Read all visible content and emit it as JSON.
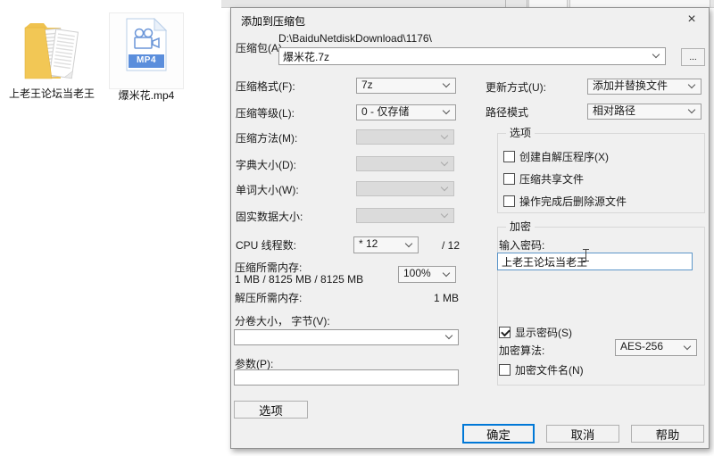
{
  "colors": {
    "accent": "#0078d7",
    "mp4_badge": "#5b8edc",
    "folder_yellow": "#efc24f",
    "dialog_bg": "#f0f0f0"
  },
  "desktop": {
    "folder": {
      "label": "上老王论坛当老王"
    },
    "file": {
      "label": "爆米花.mp4",
      "badge": "MP4"
    }
  },
  "dialog": {
    "title": "添加到压缩包",
    "close_glyph": "×",
    "archive": {
      "label": "压缩包(A)",
      "path": "D:\\BaiduNetdiskDownload\\1176\\",
      "name": "爆米花.7z",
      "browse": "..."
    },
    "format": {
      "label": "压缩格式(F):",
      "value": "7z"
    },
    "level": {
      "label": "压缩等级(L):",
      "value": "0 - 仅存储"
    },
    "method": {
      "label": "压缩方法(M):",
      "value": ""
    },
    "dict": {
      "label": "字典大小(D):",
      "value": ""
    },
    "word": {
      "label": "单词大小(W):",
      "value": ""
    },
    "solid": {
      "label": "固实数据大小:",
      "value": ""
    },
    "cpu": {
      "label": "CPU 线程数:",
      "value": "* 12",
      "suffix": "/ 12"
    },
    "mem_compress": {
      "label": "压缩所需内存:",
      "detail": "1 MB / 8125 MB / 8125 MB",
      "percent": "100%"
    },
    "mem_decompress": {
      "label": "解压所需内存:",
      "value": "1 MB"
    },
    "volume": {
      "label": "分卷大小， 字节(V):",
      "value": ""
    },
    "params": {
      "label": "参数(P):",
      "value": ""
    },
    "options_button": "选项",
    "update": {
      "label": "更新方式(U):",
      "value": "添加并替换文件"
    },
    "path_mode": {
      "label": "路径模式",
      "value": "相对路径"
    },
    "options_group": {
      "title": "选项",
      "items": [
        "创建自解压程序(X)",
        "压缩共享文件",
        "操作完成后删除源文件"
      ]
    },
    "encrypt_group": {
      "title": "加密",
      "password_label": "输入密码:",
      "password_value": "上老王论坛当老王",
      "show_password": "显示密码(S)",
      "algo_label": "加密算法:",
      "algo_value": "AES-256",
      "encrypt_names": "加密文件名(N)"
    },
    "buttons": {
      "ok": "确定",
      "cancel": "取消",
      "help": "帮助"
    }
  }
}
